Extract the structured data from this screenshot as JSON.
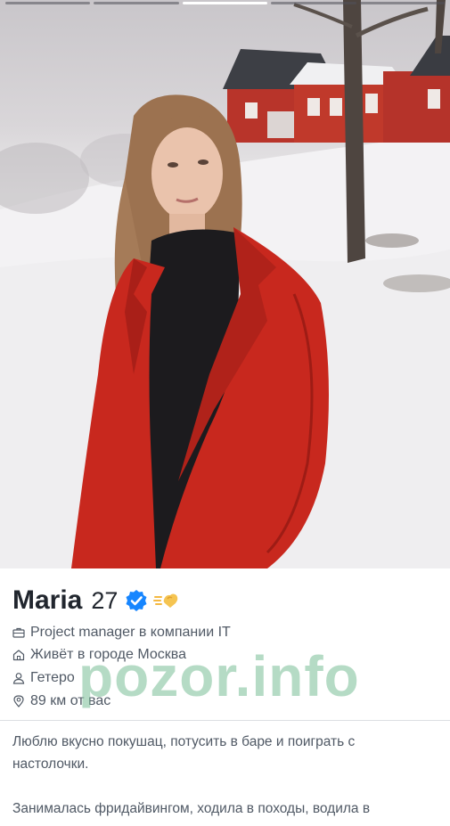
{
  "profile": {
    "name": "Maria",
    "age": "27",
    "job": "Project manager в компании IT",
    "city": "Живёт в городе Москва",
    "orientation": "Гетеро",
    "distance": "89 км от вас",
    "bio": {
      "paragraph1_line1": "Люблю вкусно покушац, потусить в баре и поиграть с",
      "paragraph1_line2": "настолочки.",
      "paragraph2_line1": "Занималась фридайвингом, ходила в походы, водила в"
    }
  },
  "photo_progress": {
    "total": 5,
    "active_index": 2
  },
  "watermark": "pozor.info",
  "icons": {
    "verified": "verified-check-icon",
    "superlike": "super-like-icon",
    "job": "briefcase-icon",
    "city": "home-icon",
    "orientation": "person-icon",
    "distance": "location-pin-icon"
  },
  "colors": {
    "verified_blue": "#1786ff",
    "coat_red": "#c8281e",
    "text_primary": "#21262e",
    "text_secondary": "#505965",
    "watermark_green": "#78be96"
  }
}
